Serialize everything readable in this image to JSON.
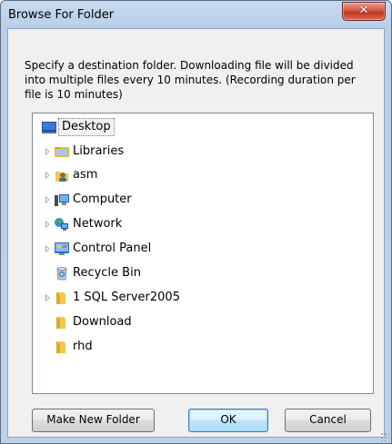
{
  "window": {
    "title": "Browse For Folder"
  },
  "description": "Specify a destination folder. Downloading file will be divided into multiple files every 10 minutes. (Recording duration per file is 10 minutes)",
  "tree": {
    "items": [
      {
        "label": "Desktop",
        "icon": "desktop-icon",
        "expandable": false,
        "selected": true
      },
      {
        "label": "Libraries",
        "icon": "libraries-icon",
        "expandable": true
      },
      {
        "label": "asm",
        "icon": "user-folder-icon",
        "expandable": true
      },
      {
        "label": "Computer",
        "icon": "computer-icon",
        "expandable": true
      },
      {
        "label": "Network",
        "icon": "network-icon",
        "expandable": true
      },
      {
        "label": "Control Panel",
        "icon": "control-panel-icon",
        "expandable": true
      },
      {
        "label": "Recycle Bin",
        "icon": "recycle-bin-icon",
        "expandable": false
      },
      {
        "label": "1 SQL Server2005",
        "icon": "folder-icon",
        "expandable": true
      },
      {
        "label": "Download",
        "icon": "folder-icon",
        "expandable": false
      },
      {
        "label": "rhd",
        "icon": "folder-icon",
        "expandable": false
      }
    ]
  },
  "buttons": {
    "make_new_folder": "Make New Folder",
    "ok": "OK",
    "cancel": "Cancel"
  },
  "colors": {
    "title_gradient_top": "#c7d9ef",
    "close_button": "#c2361f",
    "selection_outline": "#7a7a7a",
    "folder_yellow": "#f1c84b"
  }
}
